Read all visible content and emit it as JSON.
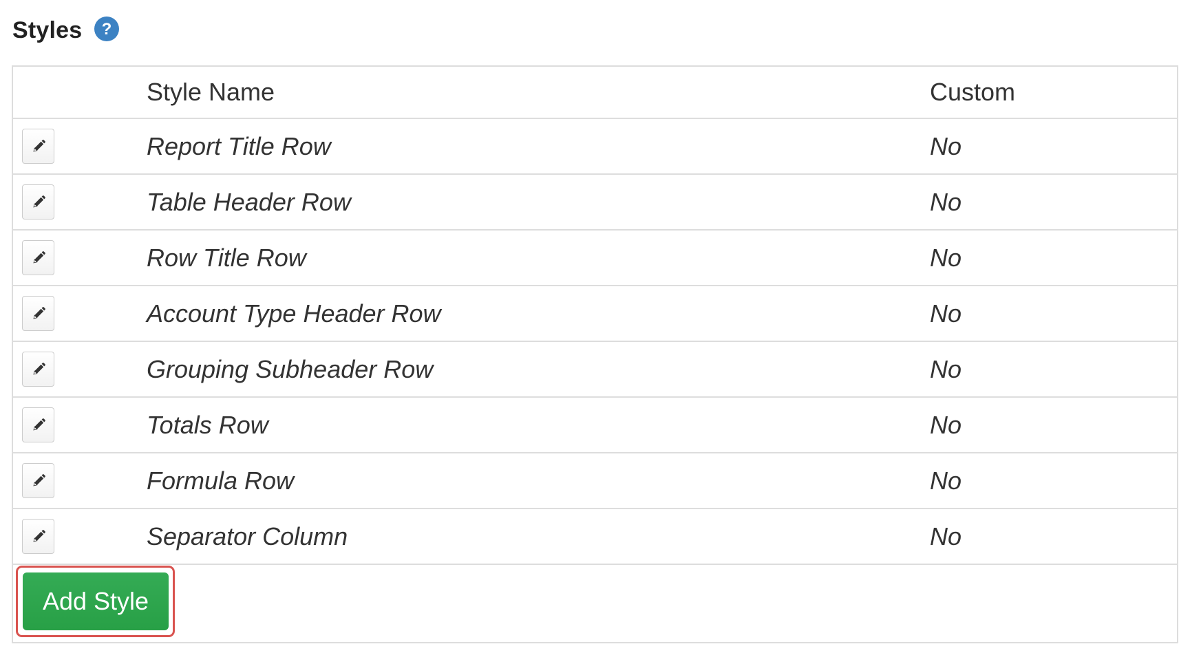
{
  "section": {
    "title": "Styles",
    "help_icon": "question-circle-icon",
    "help_icon_color": "#3c82c3"
  },
  "table": {
    "columns": {
      "style_name": "Style Name",
      "custom": "Custom"
    },
    "rows": [
      {
        "name": "Report Title Row",
        "custom": "No",
        "edit_icon": "pencil-icon"
      },
      {
        "name": "Table Header Row",
        "custom": "No",
        "edit_icon": "pencil-icon"
      },
      {
        "name": "Row Title Row",
        "custom": "No",
        "edit_icon": "pencil-icon"
      },
      {
        "name": "Account Type Header Row",
        "custom": "No",
        "edit_icon": "pencil-icon"
      },
      {
        "name": "Grouping Subheader Row",
        "custom": "No",
        "edit_icon": "pencil-icon"
      },
      {
        "name": "Totals Row",
        "custom": "No",
        "edit_icon": "pencil-icon"
      },
      {
        "name": "Formula Row",
        "custom": "No",
        "edit_icon": "pencil-icon"
      },
      {
        "name": "Separator Column",
        "custom": "No",
        "edit_icon": "pencil-icon"
      }
    ]
  },
  "actions": {
    "add_style_label": "Add Style",
    "add_style_color": "#2ea44f",
    "highlight_color": "#d9534f"
  }
}
